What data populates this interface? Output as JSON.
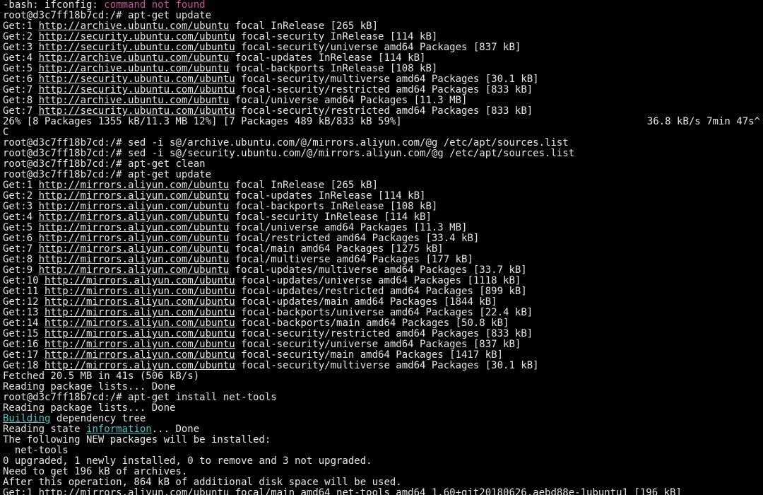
{
  "preline": {
    "prefix": "-bash: ifconfig: ",
    "msg": "command not found"
  },
  "prompt": "root@d3c7ff18b7cd:/#",
  "cmds": {
    "apt_update1": "apt-get update",
    "sed1": "sed -i s@/archive.ubuntu.com/@/mirrors.aliyun.com/@g /etc/apt/sources.list",
    "sed2": "sed -i s@/security.ubuntu.com/@/mirrors.aliyun.com/@g /etc/apt/sources.list",
    "apt_clean": "apt-get clean",
    "apt_update2": "apt-get update",
    "apt_install": "apt-get install net-tools"
  },
  "urls": {
    "archive": "http://archive.ubuntu.com/ubuntu",
    "security": "http://security.ubuntu.com/ubuntu",
    "aliyun": "http://mirrors.aliyun.com/ubuntu"
  },
  "run1": [
    {
      "n": "1",
      "url": "archive",
      "suffix": " focal InRelease [265 kB]"
    },
    {
      "n": "2",
      "url": "security",
      "suffix": " focal-security InRelease [114 kB]"
    },
    {
      "n": "3",
      "url": "security",
      "suffix": " focal-security/universe amd64 Packages [837 kB]"
    },
    {
      "n": "4",
      "url": "archive",
      "suffix": " focal-updates InRelease [114 kB]"
    },
    {
      "n": "5",
      "url": "archive",
      "suffix": " focal-backports InRelease [108 kB]"
    },
    {
      "n": "6",
      "url": "security",
      "suffix": " focal-security/multiverse amd64 Packages [30.1 kB]"
    },
    {
      "n": "7",
      "url": "security",
      "suffix": " focal-security/restricted amd64 Packages [833 kB]"
    },
    {
      "n": "8",
      "url": "archive",
      "suffix": " focal/universe amd64 Packages [11.3 MB]"
    },
    {
      "n": "7",
      "url": "security",
      "suffix": " focal-security/restricted amd64 Packages [833 kB]"
    }
  ],
  "progress": {
    "line": "26% [8 Packages 1355 kB/11.3 MB 12%] [7 Packages 489 kB/833 kB 59%]",
    "rate": "36.8 kB/s 7min 47s^",
    "ctrlc": "C"
  },
  "run2": [
    {
      "n": "1",
      "suffix": " focal InRelease [265 kB]"
    },
    {
      "n": "2",
      "suffix": " focal-updates InRelease [114 kB]"
    },
    {
      "n": "3",
      "suffix": " focal-backports InRelease [108 kB]"
    },
    {
      "n": "4",
      "suffix": " focal-security InRelease [114 kB]"
    },
    {
      "n": "5",
      "suffix": " focal/universe amd64 Packages [11.3 MB]"
    },
    {
      "n": "6",
      "suffix": " focal/restricted amd64 Packages [33.4 kB]"
    },
    {
      "n": "7",
      "suffix": " focal/main amd64 Packages [1275 kB]"
    },
    {
      "n": "8",
      "suffix": " focal/multiverse amd64 Packages [177 kB]"
    },
    {
      "n": "9",
      "suffix": " focal-updates/multiverse amd64 Packages [33.7 kB]"
    },
    {
      "n": "10",
      "suffix": " focal-updates/universe amd64 Packages [1118 kB]"
    },
    {
      "n": "11",
      "suffix": " focal-updates/restricted amd64 Packages [899 kB]"
    },
    {
      "n": "12",
      "suffix": " focal-updates/main amd64 Packages [1844 kB]"
    },
    {
      "n": "13",
      "suffix": " focal-backports/universe amd64 Packages [22.4 kB]"
    },
    {
      "n": "14",
      "suffix": " focal-backports/main amd64 Packages [50.8 kB]"
    },
    {
      "n": "15",
      "suffix": " focal-security/restricted amd64 Packages [833 kB]"
    },
    {
      "n": "16",
      "suffix": " focal-security/universe amd64 Packages [837 kB]"
    },
    {
      "n": "17",
      "suffix": " focal-security/main amd64 Packages [1417 kB]"
    },
    {
      "n": "18",
      "suffix": " focal-security/multiverse amd64 Packages [30.1 kB]"
    }
  ],
  "after_update": {
    "fetched": "Fetched 20.5 MB in 41s (506 kB/s)",
    "reading1": "Reading package lists... Done",
    "reading2": "Reading package lists... Done",
    "building_word": "Building",
    "building_rest": " dependency tree",
    "reading_state_pre": "Reading state ",
    "information_word": "information",
    "reading_state_post": "... Done",
    "new_pkg_header": "The following NEW packages will be installed:",
    "new_pkg": "  net-tools",
    "summary": "0 upgraded, 1 newly installed, 0 to remove and 3 not upgraded.",
    "need": "Need to get 196 kB of archives.",
    "after_op": "After this operation, 864 kB of additional disk space will be used.",
    "get_pkg_prefix": "Get:1 ",
    "get_pkg_suffix": " focal/main amd64 net-tools amd64 1.60+git20180626.aebd88e-1ubuntu1 [196 kB]"
  },
  "labels": {
    "get_prefix": "Get:"
  }
}
